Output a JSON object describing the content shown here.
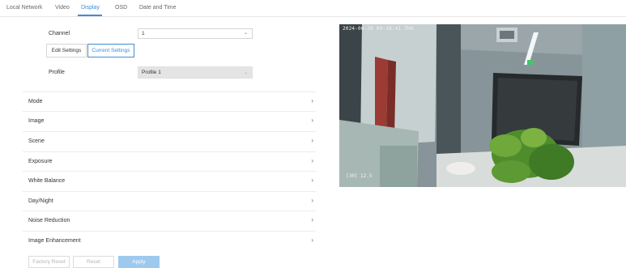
{
  "tabs": [
    {
      "label": "Local Network",
      "active": false
    },
    {
      "label": "Video",
      "active": false
    },
    {
      "label": "Display",
      "active": true
    },
    {
      "label": "OSD",
      "active": false
    },
    {
      "label": "Date and Time",
      "active": false
    }
  ],
  "form": {
    "channel_label": "Channel",
    "channel_value": "1",
    "edit_settings_label": "Edit Settings",
    "current_settings_label": "Current Settings",
    "profile_label": "Profile",
    "profile_value": "Profile 1"
  },
  "sections": [
    {
      "label": "Mode"
    },
    {
      "label": "Image"
    },
    {
      "label": "Scene"
    },
    {
      "label": "Exposure"
    },
    {
      "label": "White Balance"
    },
    {
      "label": "Day/Night"
    },
    {
      "label": "Noise Reduction"
    },
    {
      "label": "Image Enhancement"
    }
  ],
  "buttons": {
    "factory_reset": "Factory Reset",
    "reset": "Reset",
    "apply": "Apply"
  },
  "preview": {
    "osd_time": "2024-06-20 09:18:41 THU",
    "osd_camera": "[30] 12.5"
  },
  "colors": {
    "accent": "#3a8fd9",
    "apply_disabled": "#9ec9ef"
  },
  "icons": {
    "dropdown": "chevron-down-icon",
    "section_expand": "chevron-right-icon"
  }
}
